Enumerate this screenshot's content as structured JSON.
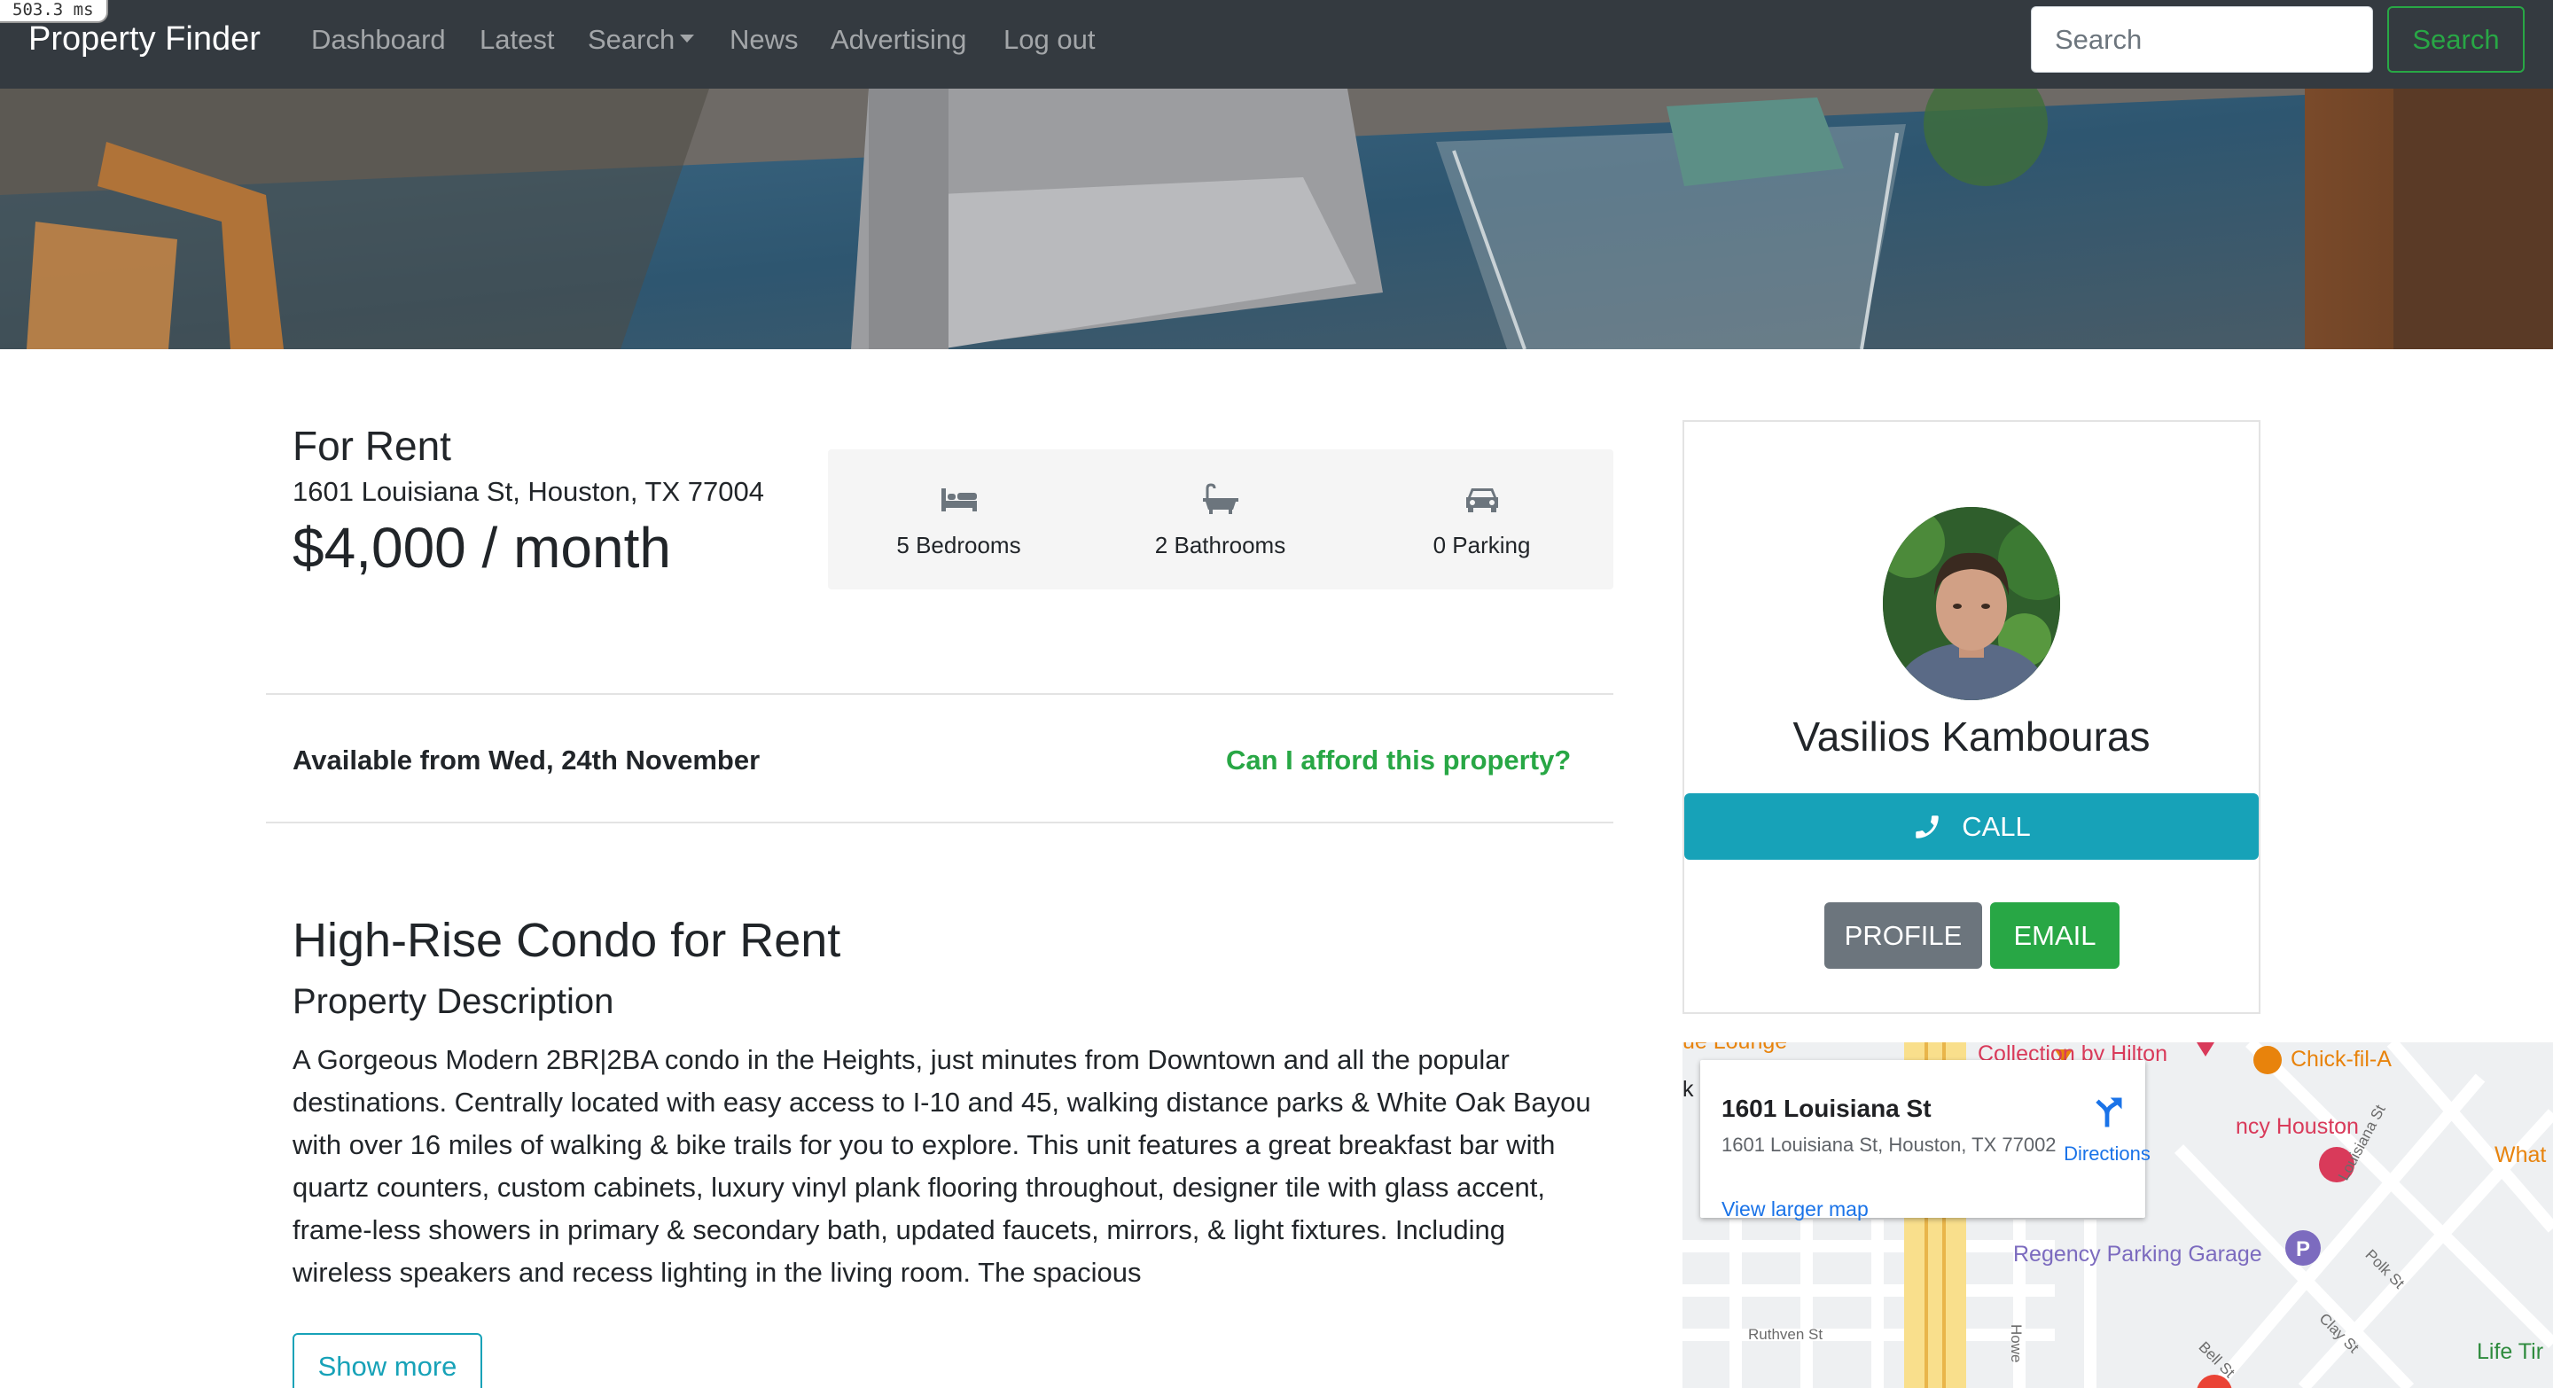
{
  "debug": {
    "timing": "503.3 ms"
  },
  "navbar": {
    "brand": "Property Finder",
    "links": [
      "Dashboard",
      "Latest",
      "Search",
      "News",
      "Advertising",
      "Log out"
    ],
    "search_placeholder": "Search",
    "search_button": "Search"
  },
  "listing": {
    "type": "For Rent",
    "address": "1601 Louisiana St, Houston, TX 77004",
    "price": "$4,000 / month",
    "features": [
      {
        "icon": "bed-icon",
        "label": "5 Bedrooms"
      },
      {
        "icon": "bath-icon",
        "label": "2 Bathrooms"
      },
      {
        "icon": "car-icon",
        "label": "0 Parking"
      }
    ],
    "available": "Available from Wed, 24th November",
    "afford_link": "Can I afford this property?",
    "title": "High-Rise Condo for Rent",
    "description_heading": "Property Description",
    "description": "A Gorgeous Modern 2BR|2BA condo in the Heights, just minutes from Downtown and all the popular destinations. Centrally located with easy access to I-10 and 45, walking distance parks & White Oak Bayou with over 16 miles of walking & bike trails for you to explore. This unit features a great breakfast bar with quartz counters, custom cabinets, luxury vinyl plank flooring throughout, designer tile with glass accent, frame-less showers in primary & secondary bath, updated faucets, mirrors, & light fixtures. Including wireless speakers and recess lighting in the living room. The spacious",
    "show_more": "Show more"
  },
  "agent": {
    "name": "Vasilios Kambouras",
    "call_label": "CALL",
    "profile_label": "PROFILE",
    "email_label": "EMAIL"
  },
  "map": {
    "card_title": "1601 Louisiana St",
    "card_address": "1601 Louisiana St, Houston, TX 77002",
    "directions": "Directions",
    "larger_map": "View larger map",
    "pois": [
      "Collection by Hilton",
      "Chick-fil-A",
      "ncy Houston",
      "What",
      "Regency Parking Garage",
      "Life Tir",
      "ue Lounge",
      "k"
    ],
    "streets": [
      "Louisiana St",
      "Polk St",
      "Clay St",
      "Bell St",
      "Ruthven St",
      "Howe"
    ],
    "colors": {
      "poi_red": "#d93a5a",
      "poi_orange": "#e8830c",
      "poi_purple": "#7c6bbf",
      "poi_green": "#2e8b3e"
    }
  },
  "colors": {
    "navbar_bg": "#343a40",
    "success": "#28a745",
    "info": "#17a2b8",
    "secondary": "#6c757d"
  }
}
